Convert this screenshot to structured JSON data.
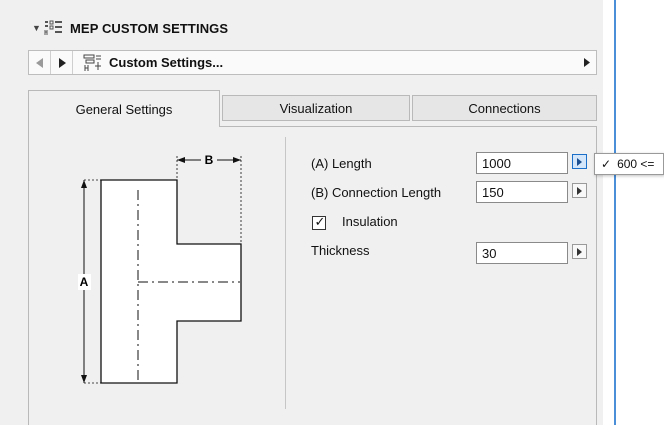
{
  "header": {
    "title": "MEP CUSTOM SETTINGS"
  },
  "navbar": {
    "title": "Custom Settings..."
  },
  "tabs": [
    {
      "label": "General Settings",
      "active": true
    },
    {
      "label": "Visualization",
      "active": false
    },
    {
      "label": "Connections",
      "active": false
    }
  ],
  "diagram": {
    "label_a": "A",
    "label_b": "B"
  },
  "fields": {
    "length": {
      "label": "(A) Length",
      "value": "1000"
    },
    "connection_length": {
      "label": "(B) Connection Length",
      "value": "150"
    },
    "insulation": {
      "label": "Insulation",
      "checked": true,
      "check_glyph": "✓"
    },
    "thickness": {
      "label": "Thickness",
      "value": "30"
    }
  },
  "popup": {
    "check_glyph": "✓",
    "text": "600 <="
  }
}
